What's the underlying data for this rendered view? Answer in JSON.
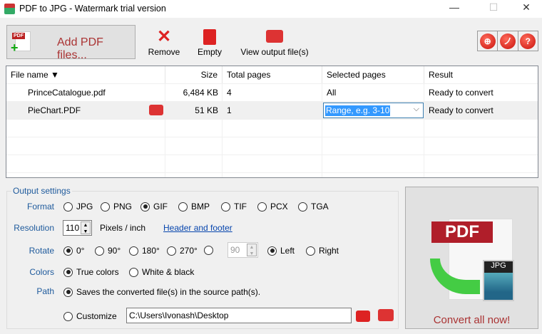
{
  "window": {
    "title": "PDF to JPG - Watermark trial version",
    "minimize": "—",
    "maximize": "☐",
    "close": "✕"
  },
  "toolbar": {
    "add_label": "Add PDF files...",
    "remove_label": "Remove",
    "empty_label": "Empty",
    "view_label": "View output file(s)",
    "right_buttons": [
      "globe-icon",
      "wrench-icon",
      "help-icon"
    ]
  },
  "table": {
    "headers": [
      "File name ▼",
      "Size",
      "Total pages",
      "Selected pages",
      "Result"
    ],
    "rows": [
      {
        "name": "PrinceCatalogue.pdf",
        "size": "6,484 KB",
        "pages": "4",
        "selected": "All",
        "result": "Ready to convert"
      },
      {
        "name": "PieChart.PDF",
        "size": "51 KB",
        "pages": "1",
        "selected": "Range, e.g. 3-10",
        "result": "Ready to convert"
      }
    ]
  },
  "settings": {
    "title": "Output settings",
    "format_label": "Format",
    "formats": [
      "JPG",
      "PNG",
      "GIF",
      "BMP",
      "TIF",
      "PCX",
      "TGA"
    ],
    "format_selected": "GIF",
    "resolution_label": "Resolution",
    "resolution": "110",
    "resolution_unit": "Pixels / inch",
    "header_footer": "Header and footer",
    "rotate_label": "Rotate",
    "rotations": [
      "0°",
      "90°",
      "180°",
      "270°"
    ],
    "rotate_custom": "90",
    "direction": [
      "Left",
      "Right"
    ],
    "colors_label": "Colors",
    "colors": [
      "True colors",
      "White & black"
    ],
    "path_label": "Path",
    "path_source": "Saves the converted file(s) in the source path(s).",
    "customize": "Customize",
    "path_value": "C:\\Users\\Ivonash\\Desktop"
  },
  "convert": {
    "label": "Convert all now!",
    "pdf_text": "PDF",
    "jpg_text": "JPG"
  },
  "colors": {
    "accent_red": "#aa3333",
    "label_blue": "#1e5a9c"
  }
}
